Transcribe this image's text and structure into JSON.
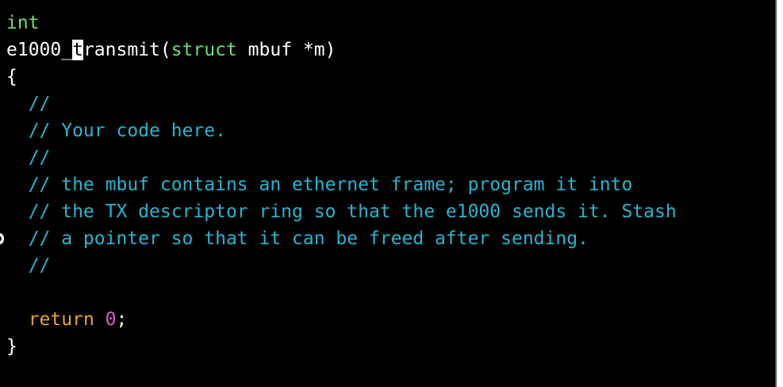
{
  "editor": {
    "lines": [
      [
        {
          "t": "int",
          "k": "type"
        }
      ],
      [
        {
          "t": "e1000_",
          "k": "default"
        },
        {
          "t": "t",
          "k": "cursor"
        },
        {
          "t": "ransmit(",
          "k": "default"
        },
        {
          "t": "struct",
          "k": "type"
        },
        {
          "t": " mbuf *m)",
          "k": "default"
        }
      ],
      [
        {
          "t": "{",
          "k": "default"
        }
      ],
      [
        {
          "t": "  //",
          "k": "comment"
        }
      ],
      [
        {
          "t": "  // Your code here.",
          "k": "comment"
        }
      ],
      [
        {
          "t": "  //",
          "k": "comment"
        }
      ],
      [
        {
          "t": "  // the mbuf contains an ethernet frame; program it into",
          "k": "comment"
        }
      ],
      [
        {
          "t": "  // the TX descriptor ring so that the e1000 sends it. Stash",
          "k": "comment"
        }
      ],
      [
        {
          "t": "  // a pointer so that it can be freed after sending.",
          "k": "comment"
        }
      ],
      [
        {
          "t": "  //",
          "k": "comment"
        }
      ],
      [
        {
          "t": "",
          "k": "default"
        }
      ],
      [
        {
          "t": "  ",
          "k": "default"
        },
        {
          "t": "return",
          "k": "keyword"
        },
        {
          "t": " ",
          "k": "default"
        },
        {
          "t": "0",
          "k": "number"
        },
        {
          "t": ";",
          "k": "default"
        }
      ],
      [
        {
          "t": "}",
          "k": "default"
        }
      ]
    ]
  },
  "colors": {
    "background": "#000000",
    "type": "#6fdc6f",
    "keyword": "#e8a32a",
    "number": "#d85ec8",
    "comment": "#27b6d1",
    "text": "#ffffff"
  }
}
